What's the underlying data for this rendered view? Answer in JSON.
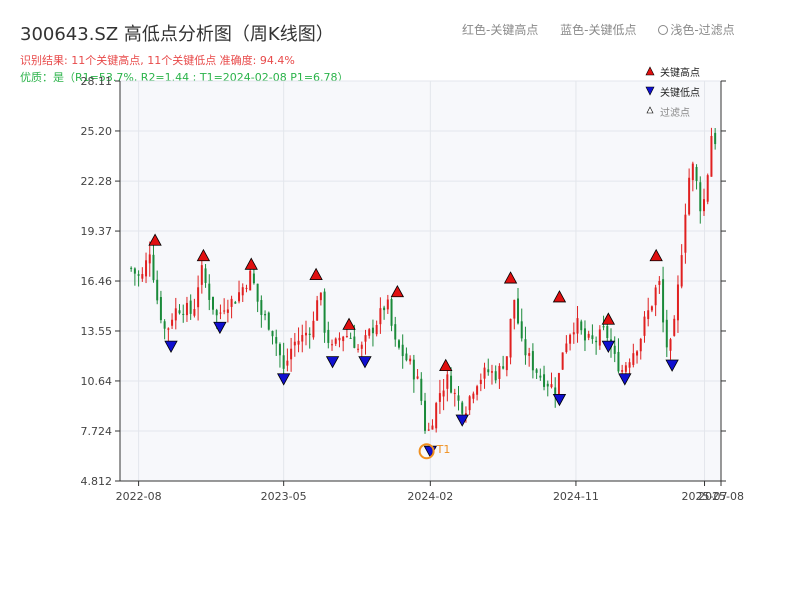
{
  "title": "300643.SZ 高低点分析图（周K线图）",
  "summary": "识别结果: 11个关键高点, 11个关键低点  准确度: 94.4%",
  "quality": "优质：是（R1=53.7%, R2=1.44 ; T1=2024-02-08 P1=6.78）",
  "top_legend": {
    "red": "红色-关键高点",
    "blue": "蓝色-关键低点",
    "light": "浅色-过滤点"
  },
  "colors": {
    "up": "#e02020",
    "down": "#1a8a3a",
    "high_marker": "#e01010",
    "low_marker": "#1010d0",
    "t1": "#f09020",
    "plot_bg": "#f7f8fb"
  },
  "chart_data": {
    "type": "candlestick",
    "title": "300643.SZ 高低点分析图（周K线图）",
    "ylim": [
      4.812,
      28.11
    ],
    "y_ticks": [
      "4.812",
      "7.724",
      "10.64",
      "13.55",
      "16.46",
      "19.37",
      "22.28",
      "25.20",
      "28.11"
    ],
    "x_ticks": [
      "2022-08",
      "2023-05",
      "2024-02",
      "2024-11",
      "2025-07",
      "2025-08"
    ],
    "legend": [
      "关键高点",
      "关键低点",
      "过滤点"
    ],
    "key_highs": [
      {
        "date": "2022-09",
        "price": 18.6
      },
      {
        "date": "2022-12",
        "price": 17.7
      },
      {
        "date": "2023-03",
        "price": 17.2
      },
      {
        "date": "2023-07",
        "price": 16.6
      },
      {
        "date": "2023-09",
        "price": 13.7
      },
      {
        "date": "2023-12",
        "price": 15.6
      },
      {
        "date": "2024-03",
        "price": 11.3
      },
      {
        "date": "2024-07",
        "price": 16.4
      },
      {
        "date": "2024-10",
        "price": 15.3
      },
      {
        "date": "2025-01",
        "price": 14.0
      },
      {
        "date": "2025-04",
        "price": 17.7
      }
    ],
    "key_lows": [
      {
        "date": "2022-10",
        "price": 12.9
      },
      {
        "date": "2023-01",
        "price": 14.0
      },
      {
        "date": "2023-05",
        "price": 11.0
      },
      {
        "date": "2023-08",
        "price": 12.0
      },
      {
        "date": "2023-10",
        "price": 12.0
      },
      {
        "date": "2024-02",
        "price": 6.78
      },
      {
        "date": "2024-04",
        "price": 8.6
      },
      {
        "date": "2024-10",
        "price": 9.8
      },
      {
        "date": "2025-01",
        "price": 12.9
      },
      {
        "date": "2025-02",
        "price": 11.0
      },
      {
        "date": "2025-05",
        "price": 11.8
      }
    ],
    "t1_label": "T1",
    "t1": {
      "date": "2024-02-08",
      "price": 6.78
    },
    "close_path": [
      [
        "2022-08-01",
        17.2
      ],
      [
        "2022-08-20",
        16.5
      ],
      [
        "2022-09-05",
        18.3
      ],
      [
        "2022-09-20",
        15.2
      ],
      [
        "2022-10-05",
        13.4
      ],
      [
        "2022-10-20",
        14.7
      ],
      [
        "2022-11-05",
        15.0
      ],
      [
        "2022-11-25",
        14.5
      ],
      [
        "2022-12-10",
        17.2
      ],
      [
        "2022-12-25",
        15.7
      ],
      [
        "2023-01-10",
        14.3
      ],
      [
        "2023-01-25",
        15.2
      ],
      [
        "2023-02-10",
        15.3
      ],
      [
        "2023-03-01",
        16.2
      ],
      [
        "2023-03-15",
        16.9
      ],
      [
        "2023-04-01",
        14.6
      ],
      [
        "2023-04-20",
        13.9
      ],
      [
        "2023-05-05",
        12.5
      ],
      [
        "2023-05-15",
        11.2
      ],
      [
        "2023-06-01",
        12.8
      ],
      [
        "2023-06-20",
        13.2
      ],
      [
        "2023-07-10",
        14.0
      ],
      [
        "2023-07-20",
        16.3
      ],
      [
        "2023-08-01",
        13.5
      ],
      [
        "2023-08-15",
        12.4
      ],
      [
        "2023-09-01",
        13.4
      ],
      [
        "2023-09-20",
        13.2
      ],
      [
        "2023-10-05",
        12.3
      ],
      [
        "2023-10-25",
        13.5
      ],
      [
        "2023-11-10",
        14.3
      ],
      [
        "2023-11-25",
        15.3
      ],
      [
        "2023-12-10",
        12.8
      ],
      [
        "2023-12-25",
        12.2
      ],
      [
        "2024-01-10",
        11.5
      ],
      [
        "2024-01-25",
        10.4
      ],
      [
        "2024-02-08",
        7.3
      ],
      [
        "2024-02-20",
        8.6
      ],
      [
        "2024-03-05",
        10.1
      ],
      [
        "2024-03-20",
        10.8
      ],
      [
        "2024-04-05",
        9.5
      ],
      [
        "2024-04-20",
        9.0
      ],
      [
        "2024-05-10",
        10.6
      ],
      [
        "2024-06-01",
        11.2
      ],
      [
        "2024-06-20",
        11.0
      ],
      [
        "2024-07-10",
        12.3
      ],
      [
        "2024-07-20",
        15.8
      ],
      [
        "2024-08-05",
        12.7
      ],
      [
        "2024-08-25",
        11.6
      ],
      [
        "2024-09-10",
        10.9
      ],
      [
        "2024-09-25",
        10.5
      ],
      [
        "2024-10-10",
        10.0
      ],
      [
        "2024-10-20",
        12.4
      ],
      [
        "2024-11-01",
        13.4
      ],
      [
        "2024-11-15",
        14.1
      ],
      [
        "2024-12-01",
        13.0
      ],
      [
        "2024-12-20",
        12.9
      ],
      [
        "2025-01-10",
        13.6
      ],
      [
        "2025-01-25",
        12.0
      ],
      [
        "2025-02-10",
        11.3
      ],
      [
        "2025-02-25",
        12.1
      ],
      [
        "2025-03-15",
        13.0
      ],
      [
        "2025-03-25",
        14.2
      ],
      [
        "2025-04-05",
        15.0
      ],
      [
        "2025-04-20",
        16.6
      ],
      [
        "2025-05-01",
        13.0
      ],
      [
        "2025-05-10",
        12.3
      ],
      [
        "2025-05-20",
        14.0
      ],
      [
        "2025-06-01",
        18.0
      ],
      [
        "2025-06-10",
        21.0
      ],
      [
        "2025-06-20",
        23.5
      ],
      [
        "2025-07-01",
        22.0
      ],
      [
        "2025-07-10",
        20.3
      ],
      [
        "2025-07-20",
        22.5
      ],
      [
        "2025-07-28",
        25.0
      ],
      [
        "2025-08-08",
        24.5
      ]
    ]
  }
}
